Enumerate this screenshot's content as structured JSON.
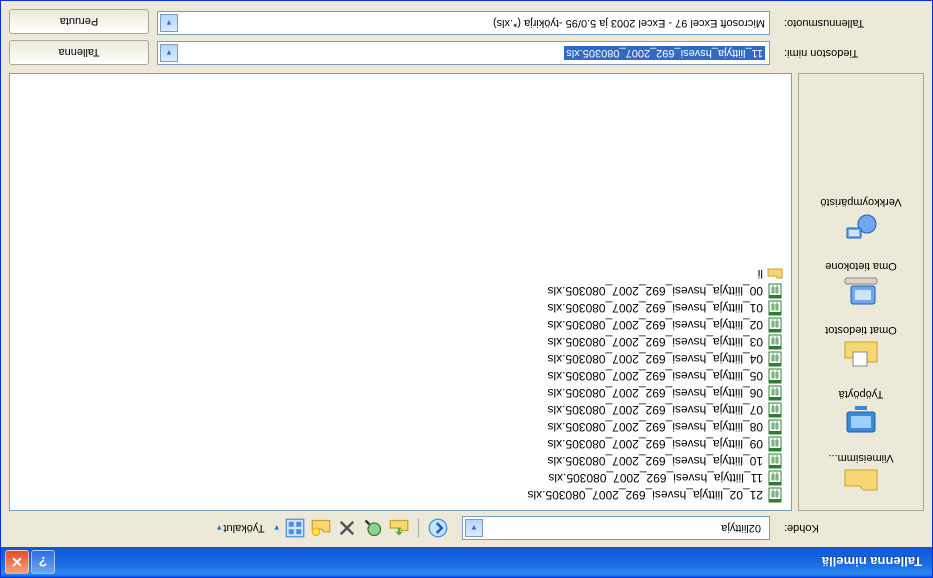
{
  "window": {
    "title": "Tallenna nimellä"
  },
  "toolbar": {
    "kohde_label": "Kohde:",
    "kohde_value": "02liittyja",
    "tyokalut_label": "Työkalut"
  },
  "places": [
    {
      "id": "viimeisimmat",
      "label": "Viimeisimm..."
    },
    {
      "id": "tyopoyta",
      "label": "Työpöytä"
    },
    {
      "id": "omat-tiedostot",
      "label": "Omat tiedostot"
    },
    {
      "id": "oma-tietokone",
      "label": "Oma tietokone"
    },
    {
      "id": "verkkoymparisto",
      "label": "Verkkoympäristö"
    }
  ],
  "folder_item": "li",
  "files": [
    "00_liittyja_hsvesi_692_2007_080305.xls",
    "01_liittyja_hsvesi_692_2007_080305.xls",
    "02_liittyja_hsvesi_692_2007_080305.xls",
    "03_liittyja_hsvesi_692_2007_080305.xls",
    "04_liittyja_hsvesi_692_2007_080305.xls",
    "05_liittyja_hsvesi_692_2007_080305.xls",
    "06_liittyja_hsvesi_692_2007_080305.xls",
    "07_liittyja_hsvesi_692_2007_080305.xls",
    "08_liittyja_hsvesi_692_2007_080305.xls",
    "09_liittyja_hsvesi_692_2007_080305.xls",
    "10_liittyja_hsvesi_692_2007_080305.xls",
    "11_liittyja_hsvesi_692_2007_080305.xls",
    "21_02_liittyja_hsvesi_692_2007_080305.xls"
  ],
  "fields": {
    "filename_label": "Tiedoston nimi:",
    "filename_value": "11_liittyja_hsvesi_692_2007_080305.xls",
    "format_label": "Tallennusmuoto:",
    "format_value": "Microsoft Excel 97 - Excel 2003 ja 5.0/95 -työkirja (*.xls)"
  },
  "buttons": {
    "save": "Tallenna",
    "cancel": "Peruuta"
  }
}
